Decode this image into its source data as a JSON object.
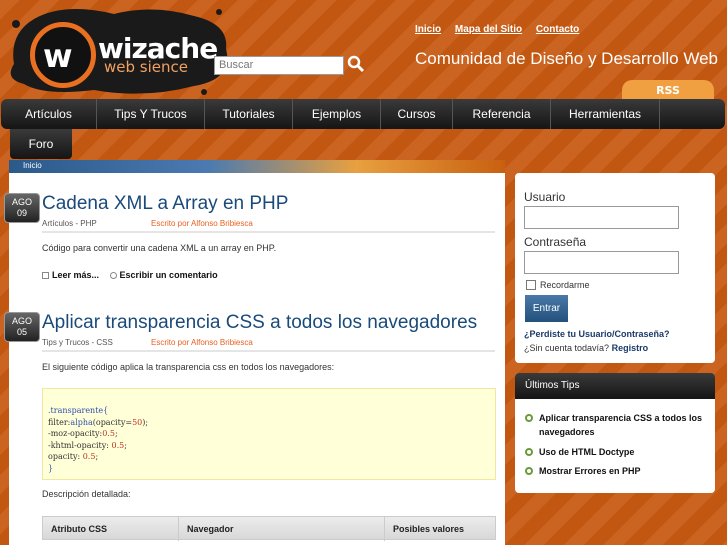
{
  "brand": {
    "logo_letter": "w",
    "logo_word": "wizache",
    "logo_sub": "web sience"
  },
  "search": {
    "placeholder": "Buscar"
  },
  "top_links": [
    "Inicio",
    "Mapa del Sitio",
    "Contacto"
  ],
  "tagline": "Comunidad de Diseño y Desarrollo Web",
  "rss_label": "RSS",
  "nav": {
    "items": [
      "Artículos",
      "Tips Y Trucos",
      "Tutoriales",
      "Ejemplos",
      "Cursos",
      "Referencia",
      "Herramientas"
    ],
    "foro": "Foro"
  },
  "breadcrumb": "Inicio",
  "posts": [
    {
      "month": "AGO",
      "day": "09",
      "title": "Cadena XML a Array en PHP",
      "meta": "Artículos - PHP",
      "author": "Escrito por Alfonso Bribiesca",
      "body": "Código para convertir una cadena XML a un array en PHP.",
      "read_more": "Leer más...",
      "comment": "Escribir un comentario"
    },
    {
      "month": "AGO",
      "day": "05",
      "title": "Aplicar transparencia CSS a todos los navegadores",
      "meta": "Tips y Trucos - CSS",
      "author": "Escrito por Alfonso Bribiesca",
      "body": "El siguiente código aplica la transparencia css en todos los navegadores:",
      "desc": "Descripción detallada:"
    }
  ],
  "code": {
    "selector": ".transparente{",
    "l2a": "filter:",
    "l2b": "alpha",
    "l2c": "(opacity=",
    "l2d": "50",
    "l2e": ");",
    "l3a": "-moz-opacity:",
    "l3b": "0.5",
    "l3c": ";",
    "l4a": "-khtml-opacity: ",
    "l4b": "0.5",
    "l4c": ";",
    "l5a": "opacity: ",
    "l5b": "0.5",
    "l5c": ";",
    "close": "}"
  },
  "table_headers": [
    "Atributo CSS",
    "Navegador",
    "Posibles valores"
  ],
  "login": {
    "user_label": "Usuario",
    "pass_label": "Contraseña",
    "remember": "Recordarme",
    "submit": "Entrar",
    "forgot": "¿Perdiste tu Usuario/Contraseña?",
    "signup_q": "¿Sin cuenta todavía?",
    "signup_link": "Registro"
  },
  "tips": {
    "title": "Últimos Tips",
    "items": [
      "Aplicar transparencia CSS a todos los navegadores",
      "Uso de HTML Doctype",
      "Mostrar Errores en PHP"
    ]
  },
  "colors": {
    "background": "#c85a12",
    "nav": "#1f1f1f",
    "title_blue": "#1a4a7a",
    "author_orange": "#e86020",
    "button_blue": "#2f5f8e"
  }
}
